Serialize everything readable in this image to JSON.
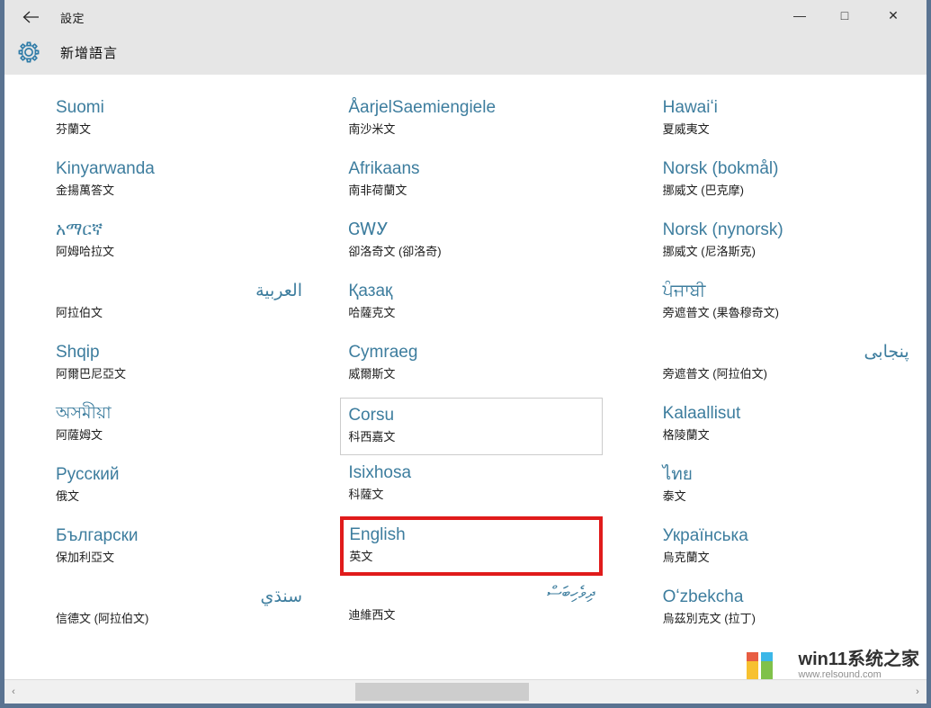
{
  "window": {
    "titlebar": {
      "back_icon": "back-arrow-icon",
      "app_title": "設定",
      "minimize_glyph": "—",
      "maximize_glyph": "□",
      "close_glyph": "✕"
    },
    "header": {
      "icon": "gear-icon",
      "page_title": "新增語言"
    }
  },
  "colors": {
    "accent_blue": "#3d7d9e",
    "titlebar_bg": "#e6e6e6",
    "frame_border": "#5a7391",
    "highlight_red": "#e01b1b",
    "focus_gray": "#cccccc"
  },
  "languages": {
    "column1": [
      {
        "native": "Suomi",
        "translated": "芬蘭文",
        "state": "normal",
        "rtl": false
      },
      {
        "native": "Kinyarwanda",
        "translated": "金揚萬答文",
        "state": "normal",
        "rtl": false
      },
      {
        "native": "አማርኛ",
        "translated": "阿姆哈拉文",
        "state": "normal",
        "rtl": false
      },
      {
        "native": "العربية",
        "translated": "阿拉伯文",
        "state": "normal",
        "rtl": true
      },
      {
        "native": "Shqip",
        "translated": "阿爾巴尼亞文",
        "state": "normal",
        "rtl": false
      },
      {
        "native": "অসমীয়া",
        "translated": "阿薩姆文",
        "state": "normal",
        "rtl": false
      },
      {
        "native": "Русский",
        "translated": "俄文",
        "state": "normal",
        "rtl": false
      },
      {
        "native": "Български",
        "translated": "保加利亞文",
        "state": "normal",
        "rtl": false
      },
      {
        "native": "سنڌي",
        "translated": "信德文 (阿拉伯文)",
        "state": "normal",
        "rtl": true
      }
    ],
    "column2": [
      {
        "native": "ÅarjelSaemiengiele",
        "translated": "南沙米文",
        "state": "normal",
        "rtl": false
      },
      {
        "native": "Afrikaans",
        "translated": "南非荷蘭文",
        "state": "normal",
        "rtl": false
      },
      {
        "native": "ᏣᎳᎩ",
        "translated": "卻洛奇文 (卻洛奇)",
        "state": "normal",
        "rtl": false
      },
      {
        "native": "Қазақ",
        "translated": "哈薩克文",
        "state": "normal",
        "rtl": false
      },
      {
        "native": "Cymraeg",
        "translated": "威爾斯文",
        "state": "normal",
        "rtl": false
      },
      {
        "native": "Corsu",
        "translated": "科西嘉文",
        "state": "focused",
        "rtl": false
      },
      {
        "native": "Isixhosa",
        "translated": "科薩文",
        "state": "normal",
        "rtl": false
      },
      {
        "native": "English",
        "translated": "英文",
        "state": "highlight",
        "rtl": false
      },
      {
        "native": "ދިވެހިބަސް",
        "translated": "迪維西文",
        "state": "normal",
        "rtl": true
      }
    ],
    "column3": [
      {
        "native": "Hawaiʻi",
        "translated": "夏威夷文",
        "state": "normal",
        "rtl": false
      },
      {
        "native": "Norsk (bokmål)",
        "translated": "挪威文 (巴克摩)",
        "state": "normal",
        "rtl": false
      },
      {
        "native": "Norsk (nynorsk)",
        "translated": "挪威文 (尼洛斯克)",
        "state": "normal",
        "rtl": false
      },
      {
        "native": "ਪੰਜਾਬੀ",
        "translated": "旁遮普文 (果魯穆奇文)",
        "state": "normal",
        "rtl": false
      },
      {
        "native": "پنجابی",
        "translated": "旁遮普文 (阿拉伯文)",
        "state": "normal",
        "rtl": true
      },
      {
        "native": "Kalaallisut",
        "translated": "格陵蘭文",
        "state": "normal",
        "rtl": false
      },
      {
        "native": "ไทย",
        "translated": "泰文",
        "state": "normal",
        "rtl": false
      },
      {
        "native": "Українська",
        "translated": "烏克蘭文",
        "state": "normal",
        "rtl": false
      },
      {
        "native": "Oʻzbekcha",
        "translated": "烏茲別克文 (拉丁)",
        "state": "normal",
        "rtl": false
      }
    ]
  },
  "scrollbar": {
    "left_arrow_glyph": "‹",
    "right_arrow_glyph": "›"
  },
  "watermark": {
    "brand": "win11系统之家",
    "url": "www.relsound.com"
  }
}
